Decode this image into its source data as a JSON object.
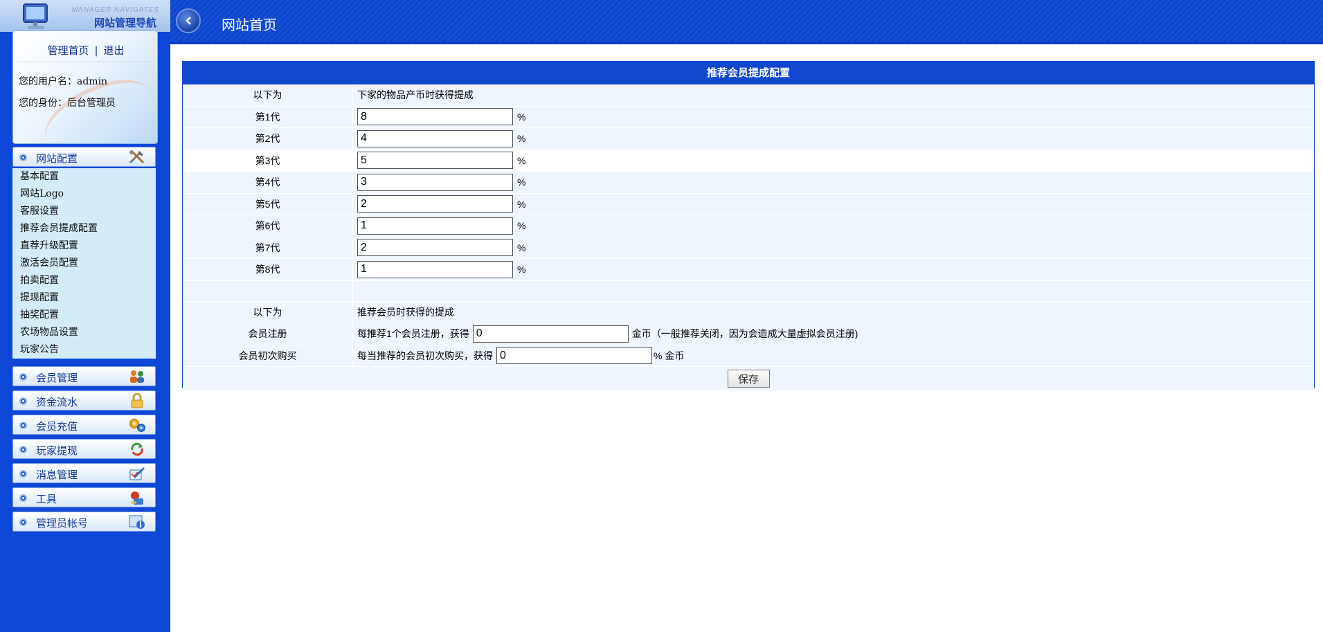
{
  "sidebar": {
    "logo_sub": "MANAGER NAVIGATES",
    "logo_title": "网站管理导航",
    "home_link": "管理首页",
    "link_sep": "|",
    "logout_link": "退出",
    "username_line": "您的用户名：admin",
    "role_line": "您的身份：后台管理员",
    "menus": [
      {
        "label": "网站配置",
        "icon": "tools-icon"
      },
      {
        "label": "会员管理",
        "icon": "users-icon"
      },
      {
        "label": "资金流水",
        "icon": "lock-icon"
      },
      {
        "label": "会员充值",
        "icon": "gears-icon"
      },
      {
        "label": "玩家提现",
        "icon": "refresh-icon"
      },
      {
        "label": "消息管理",
        "icon": "edit-icon"
      },
      {
        "label": "工具",
        "icon": "toolbox-icon"
      },
      {
        "label": "管理员帐号",
        "icon": "info-icon"
      }
    ],
    "submenu": [
      "基本配置",
      "网站Logo",
      "客服设置",
      "推荐会员提成配置",
      "直荐升级配置",
      "激活会员配置",
      "拍卖配置",
      "提现配置",
      "抽奖配置",
      "农场物品设置",
      "玩家公告"
    ]
  },
  "header": {
    "title": "网站首页",
    "back_icon": "chevron-left-icon"
  },
  "form": {
    "title": "推荐会员提成配置",
    "section1": {
      "label": "以下为",
      "desc": "下家的物品产币时获得提成"
    },
    "generations": [
      {
        "label": "第1代",
        "value": "8",
        "unit": "%"
      },
      {
        "label": "第2代",
        "value": "4",
        "unit": "%"
      },
      {
        "label": "第3代",
        "value": "5",
        "unit": "%"
      },
      {
        "label": "第4代",
        "value": "3",
        "unit": "%"
      },
      {
        "label": "第5代",
        "value": "2",
        "unit": "%"
      },
      {
        "label": "第6代",
        "value": "1",
        "unit": "%"
      },
      {
        "label": "第7代",
        "value": "2",
        "unit": "%"
      },
      {
        "label": "第8代",
        "value": "1",
        "unit": "%"
      }
    ],
    "section2": {
      "label": "以下为",
      "desc": "推荐会员时获得的提成"
    },
    "register": {
      "label": "会员注册",
      "prefix": "每推荐1个会员注册，获得",
      "value": "0",
      "suffix": "金币（一般推荐关闭，因为会造成大量虚拟会员注册)"
    },
    "first_purchase": {
      "label": "会员初次购买",
      "prefix": "每当推荐的会员初次购买，获得",
      "value": "0",
      "suffix": "% 金币"
    },
    "save_label": "保存"
  },
  "colors": {
    "sidebar_bg": "#0e46d6",
    "header_bg": "#1551d8",
    "panel_header": "#0f47cf",
    "row_bg": "#eef5fd"
  }
}
